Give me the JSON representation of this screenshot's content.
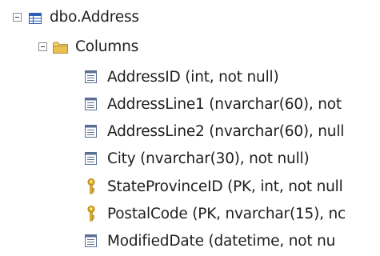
{
  "tree": {
    "table": {
      "label": "dbo.Address"
    },
    "folder": {
      "label": "Columns"
    },
    "columns": [
      {
        "label": "AddressID (int, not null)",
        "icon": "column-icon"
      },
      {
        "label": "AddressLine1 (nvarchar(60), not",
        "icon": "column-icon"
      },
      {
        "label": "AddressLine2 (nvarchar(60), null",
        "icon": "column-icon"
      },
      {
        "label": "City (nvarchar(30), not null)",
        "icon": "column-icon"
      },
      {
        "label": "StateProvinceID (PK, int, not null",
        "icon": "key-icon"
      },
      {
        "label": "PostalCode (PK, nvarchar(15), nc",
        "icon": "key-icon"
      },
      {
        "label": "ModifiedDate (datetime, not nu",
        "icon": "column-icon"
      }
    ]
  },
  "colors": {
    "table_icon_blue": "#2b5fb5",
    "folder_yellow": "#e8c14e",
    "key_gold": "#d8a21c",
    "text": "#1e1e1e"
  }
}
